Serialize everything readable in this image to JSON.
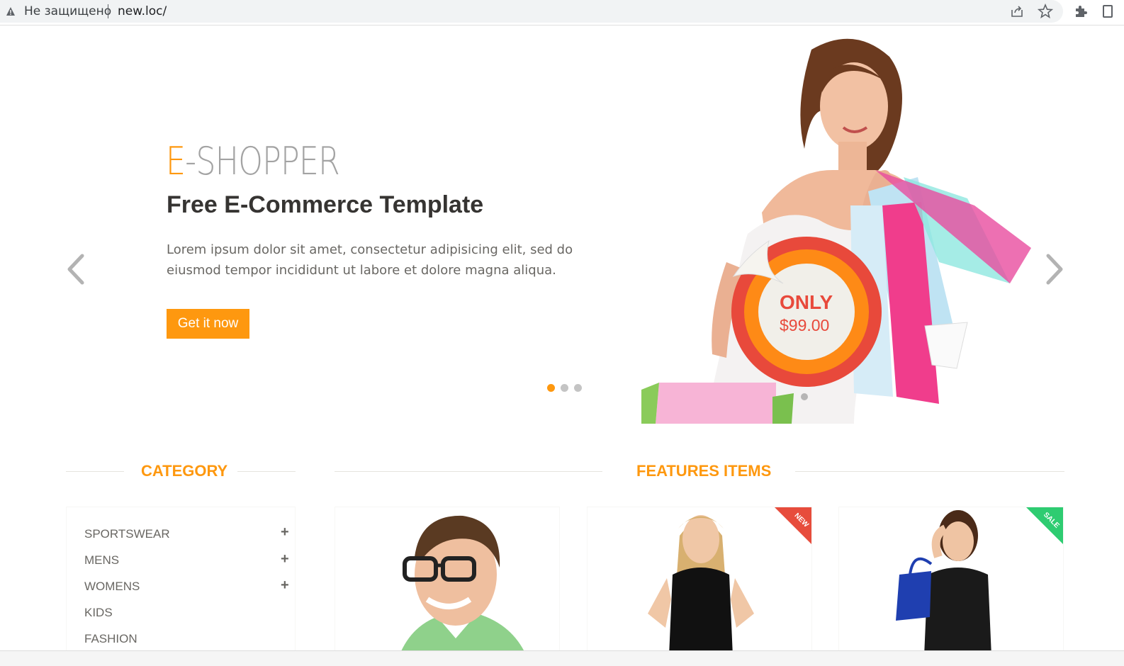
{
  "browser": {
    "security_label": "Не защищено",
    "url": "new.loc/"
  },
  "slider": {
    "brand_first": "E",
    "brand_rest": "-SHOPPER",
    "heading": "Free E-Commerce Template",
    "description_line1": "Lorem ipsum dolor sit amet, consectetur adipisicing elit, sed do",
    "description_line2": "eiusmod tempor incididunt ut labore et dolore magna aliqua.",
    "cta_label": "Get it now",
    "badge_top": "ONLY",
    "badge_price": "$99.00",
    "active_slide": 1,
    "slide_count": 3
  },
  "category": {
    "title": "CATEGORY",
    "items": [
      {
        "label": "SPORTSWEAR",
        "expandable": true
      },
      {
        "label": "MENS",
        "expandable": true
      },
      {
        "label": "WOMENS",
        "expandable": true
      },
      {
        "label": "KIDS",
        "expandable": false
      },
      {
        "label": "FASHION",
        "expandable": false
      }
    ]
  },
  "features": {
    "title": "FEATURES ITEMS",
    "products": [
      {
        "badge": ""
      },
      {
        "badge": "NEW",
        "badge_color": "#e74c3c"
      },
      {
        "badge": "SALE",
        "badge_color": "#2ecc71"
      }
    ]
  },
  "colors": {
    "accent": "#fe980f",
    "text": "#696763"
  }
}
